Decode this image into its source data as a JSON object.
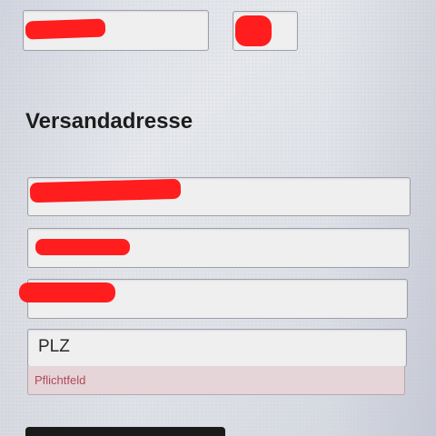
{
  "form": {
    "shipping_section_title": "Versandadresse",
    "postal_code": {
      "placeholder": "PLZ",
      "error_message": "Pflichtfeld"
    }
  }
}
